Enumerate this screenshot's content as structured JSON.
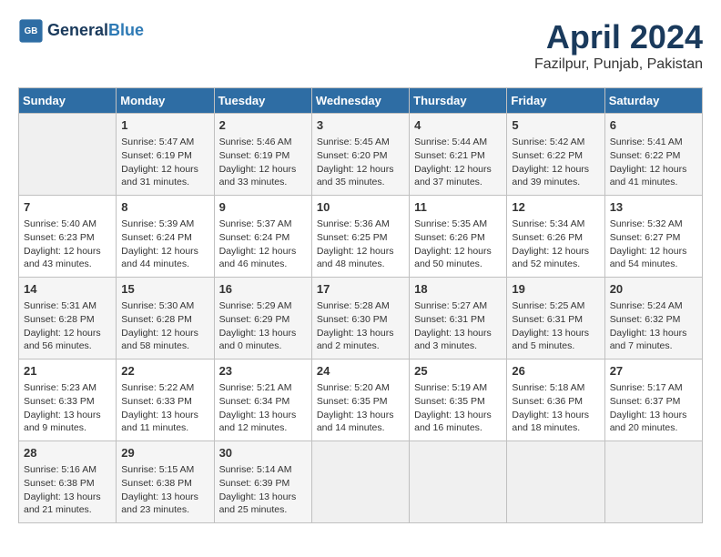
{
  "header": {
    "logo_line1": "General",
    "logo_line2": "Blue",
    "month_year": "April 2024",
    "location": "Fazilpur, Punjab, Pakistan"
  },
  "days_of_week": [
    "Sunday",
    "Monday",
    "Tuesday",
    "Wednesday",
    "Thursday",
    "Friday",
    "Saturday"
  ],
  "weeks": [
    [
      {
        "day": "",
        "info": ""
      },
      {
        "day": "1",
        "info": "Sunrise: 5:47 AM\nSunset: 6:19 PM\nDaylight: 12 hours\nand 31 minutes."
      },
      {
        "day": "2",
        "info": "Sunrise: 5:46 AM\nSunset: 6:19 PM\nDaylight: 12 hours\nand 33 minutes."
      },
      {
        "day": "3",
        "info": "Sunrise: 5:45 AM\nSunset: 6:20 PM\nDaylight: 12 hours\nand 35 minutes."
      },
      {
        "day": "4",
        "info": "Sunrise: 5:44 AM\nSunset: 6:21 PM\nDaylight: 12 hours\nand 37 minutes."
      },
      {
        "day": "5",
        "info": "Sunrise: 5:42 AM\nSunset: 6:22 PM\nDaylight: 12 hours\nand 39 minutes."
      },
      {
        "day": "6",
        "info": "Sunrise: 5:41 AM\nSunset: 6:22 PM\nDaylight: 12 hours\nand 41 minutes."
      }
    ],
    [
      {
        "day": "7",
        "info": "Sunrise: 5:40 AM\nSunset: 6:23 PM\nDaylight: 12 hours\nand 43 minutes."
      },
      {
        "day": "8",
        "info": "Sunrise: 5:39 AM\nSunset: 6:24 PM\nDaylight: 12 hours\nand 44 minutes."
      },
      {
        "day": "9",
        "info": "Sunrise: 5:37 AM\nSunset: 6:24 PM\nDaylight: 12 hours\nand 46 minutes."
      },
      {
        "day": "10",
        "info": "Sunrise: 5:36 AM\nSunset: 6:25 PM\nDaylight: 12 hours\nand 48 minutes."
      },
      {
        "day": "11",
        "info": "Sunrise: 5:35 AM\nSunset: 6:26 PM\nDaylight: 12 hours\nand 50 minutes."
      },
      {
        "day": "12",
        "info": "Sunrise: 5:34 AM\nSunset: 6:26 PM\nDaylight: 12 hours\nand 52 minutes."
      },
      {
        "day": "13",
        "info": "Sunrise: 5:32 AM\nSunset: 6:27 PM\nDaylight: 12 hours\nand 54 minutes."
      }
    ],
    [
      {
        "day": "14",
        "info": "Sunrise: 5:31 AM\nSunset: 6:28 PM\nDaylight: 12 hours\nand 56 minutes."
      },
      {
        "day": "15",
        "info": "Sunrise: 5:30 AM\nSunset: 6:28 PM\nDaylight: 12 hours\nand 58 minutes."
      },
      {
        "day": "16",
        "info": "Sunrise: 5:29 AM\nSunset: 6:29 PM\nDaylight: 13 hours\nand 0 minutes."
      },
      {
        "day": "17",
        "info": "Sunrise: 5:28 AM\nSunset: 6:30 PM\nDaylight: 13 hours\nand 2 minutes."
      },
      {
        "day": "18",
        "info": "Sunrise: 5:27 AM\nSunset: 6:31 PM\nDaylight: 13 hours\nand 3 minutes."
      },
      {
        "day": "19",
        "info": "Sunrise: 5:25 AM\nSunset: 6:31 PM\nDaylight: 13 hours\nand 5 minutes."
      },
      {
        "day": "20",
        "info": "Sunrise: 5:24 AM\nSunset: 6:32 PM\nDaylight: 13 hours\nand 7 minutes."
      }
    ],
    [
      {
        "day": "21",
        "info": "Sunrise: 5:23 AM\nSunset: 6:33 PM\nDaylight: 13 hours\nand 9 minutes."
      },
      {
        "day": "22",
        "info": "Sunrise: 5:22 AM\nSunset: 6:33 PM\nDaylight: 13 hours\nand 11 minutes."
      },
      {
        "day": "23",
        "info": "Sunrise: 5:21 AM\nSunset: 6:34 PM\nDaylight: 13 hours\nand 12 minutes."
      },
      {
        "day": "24",
        "info": "Sunrise: 5:20 AM\nSunset: 6:35 PM\nDaylight: 13 hours\nand 14 minutes."
      },
      {
        "day": "25",
        "info": "Sunrise: 5:19 AM\nSunset: 6:35 PM\nDaylight: 13 hours\nand 16 minutes."
      },
      {
        "day": "26",
        "info": "Sunrise: 5:18 AM\nSunset: 6:36 PM\nDaylight: 13 hours\nand 18 minutes."
      },
      {
        "day": "27",
        "info": "Sunrise: 5:17 AM\nSunset: 6:37 PM\nDaylight: 13 hours\nand 20 minutes."
      }
    ],
    [
      {
        "day": "28",
        "info": "Sunrise: 5:16 AM\nSunset: 6:38 PM\nDaylight: 13 hours\nand 21 minutes."
      },
      {
        "day": "29",
        "info": "Sunrise: 5:15 AM\nSunset: 6:38 PM\nDaylight: 13 hours\nand 23 minutes."
      },
      {
        "day": "30",
        "info": "Sunrise: 5:14 AM\nSunset: 6:39 PM\nDaylight: 13 hours\nand 25 minutes."
      },
      {
        "day": "",
        "info": ""
      },
      {
        "day": "",
        "info": ""
      },
      {
        "day": "",
        "info": ""
      },
      {
        "day": "",
        "info": ""
      }
    ]
  ]
}
